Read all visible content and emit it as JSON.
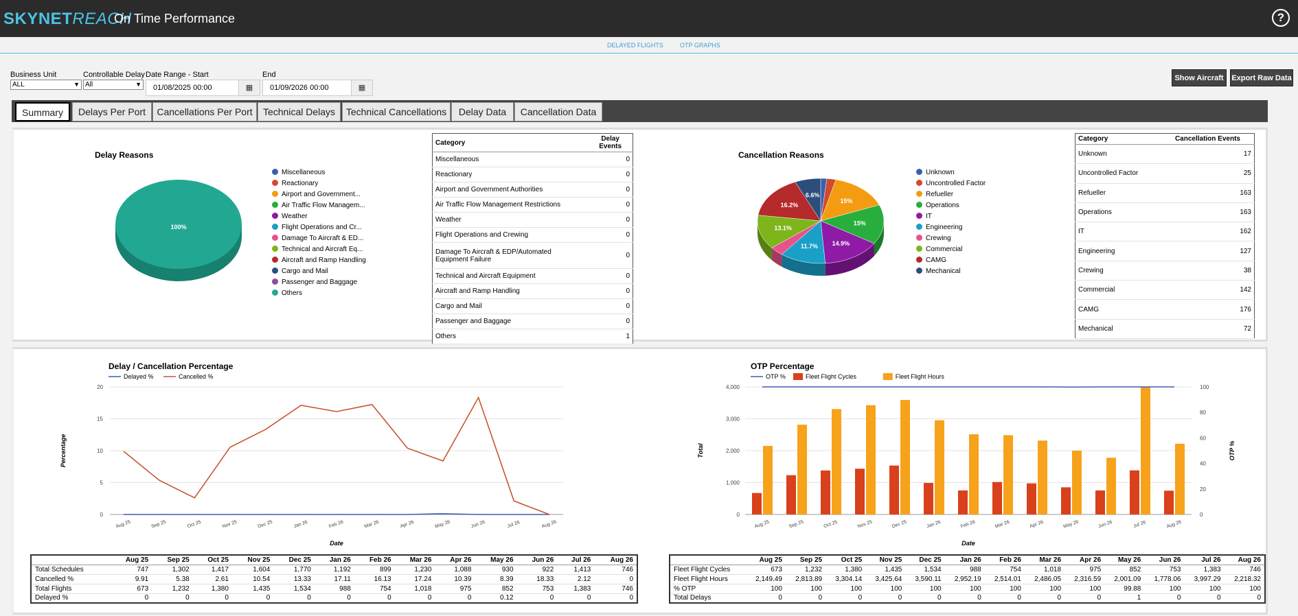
{
  "header": {
    "logo_sky": "SKYNET",
    "logo_reach": "REACH",
    "title": "On Time Performance",
    "help_glyph": "?"
  },
  "subnav": {
    "delayed_flights": "DELAYED FLIGHTS",
    "otp_graphs": "OTP GRAPHS"
  },
  "filters": {
    "business_unit_label": "Business Unit",
    "business_unit_value": "ALL",
    "controllable_delay_label": "Controllable Delay",
    "controllable_delay_value": "All",
    "date_start_label": "Date Range - Start",
    "date_start_value": "01/08/2025 00:00",
    "date_end_label": "End",
    "date_end_value": "01/09/2026 00:00",
    "calendar_icon": "calendar-icon"
  },
  "buttons": {
    "show_aircraft": "Show Aircraft",
    "export_raw": "Export Raw Data"
  },
  "tabs": [
    {
      "label": "Summary",
      "active": true
    },
    {
      "label": "Delays Per Port"
    },
    {
      "label": "Cancellations Per Port"
    },
    {
      "label": "Technical Delays"
    },
    {
      "label": "Technical Cancellations"
    },
    {
      "label": "Delay Data"
    },
    {
      "label": "Cancellation Data"
    }
  ],
  "delay_table": {
    "col_category": "Category",
    "col_events": "Delay Events",
    "rows": [
      {
        "category": "Miscellaneous",
        "events": "0"
      },
      {
        "category": "Reactionary",
        "events": "0"
      },
      {
        "category": "Airport and Government Authorities",
        "events": "0"
      },
      {
        "category": "Air Traffic Flow Management Restrictions",
        "events": "0"
      },
      {
        "category": "Weather",
        "events": "0"
      },
      {
        "category": "Flight Operations and Crewing",
        "events": "0"
      },
      {
        "category": "Damage To Aircraft & EDP/Automated Equipment Failure",
        "events": "0"
      },
      {
        "category": "Technical and Aircraft Equipment",
        "events": "0"
      },
      {
        "category": "Aircraft and Ramp Handling",
        "events": "0"
      },
      {
        "category": "Cargo and Mail",
        "events": "0"
      },
      {
        "category": "Passenger and Baggage",
        "events": "0"
      },
      {
        "category": "Others",
        "events": "1"
      }
    ]
  },
  "cancel_table": {
    "col_category": "Category",
    "col_events": "Cancellation Events",
    "rows": [
      {
        "category": "Unknown",
        "events": "17"
      },
      {
        "category": "Uncontrolled Factor",
        "events": "25"
      },
      {
        "category": "Refueller",
        "events": "163"
      },
      {
        "category": "Operations",
        "events": "163"
      },
      {
        "category": "IT",
        "events": "162"
      },
      {
        "category": "Engineering",
        "events": "127"
      },
      {
        "category": "Crewing",
        "events": "38"
      },
      {
        "category": "Commercial",
        "events": "142"
      },
      {
        "category": "CAMG",
        "events": "176"
      },
      {
        "category": "Mechanical",
        "events": "72"
      }
    ]
  },
  "chart_data": [
    {
      "type": "pie",
      "title": "Delay Reasons",
      "legend": [
        {
          "label": "Miscellaneous",
          "color": "#3a5fb0"
        },
        {
          "label": "Reactionary",
          "color": "#d14a2a"
        },
        {
          "label": "Airport and Government...",
          "color": "#f39c12"
        },
        {
          "label": "Air Traffic Flow Managem...",
          "color": "#27ae3c"
        },
        {
          "label": "Weather",
          "color": "#8e1aa6"
        },
        {
          "label": "Flight Operations and Cr...",
          "color": "#1aa0c8"
        },
        {
          "label": "Damage To Aircraft & ED...",
          "color": "#e8528a"
        },
        {
          "label": "Technical and Aircraft Eq...",
          "color": "#7db51a"
        },
        {
          "label": "Aircraft and Ramp Handling",
          "color": "#b52a2a"
        },
        {
          "label": "Cargo and Mail",
          "color": "#2c4e7a"
        },
        {
          "label": "Passenger and Baggage",
          "color": "#8e4aa6"
        },
        {
          "label": "Others",
          "color": "#22a892"
        }
      ],
      "slices": [
        {
          "label": "Others",
          "value": 100,
          "display": "100%",
          "color": "#22a892"
        }
      ]
    },
    {
      "type": "pie",
      "title": "Cancellation Reasons",
      "legend": [
        {
          "label": "Unknown",
          "color": "#3a5fb0"
        },
        {
          "label": "Uncontrolled Factor",
          "color": "#d14a2a"
        },
        {
          "label": "Refueller",
          "color": "#f39c12"
        },
        {
          "label": "Operations",
          "color": "#27ae3c"
        },
        {
          "label": "IT",
          "color": "#8e1aa6"
        },
        {
          "label": "Engineering",
          "color": "#1aa0c8"
        },
        {
          "label": "Crewing",
          "color": "#e8528a"
        },
        {
          "label": "Commercial",
          "color": "#7db51a"
        },
        {
          "label": "CAMG",
          "color": "#b52a2a"
        },
        {
          "label": "Mechanical",
          "color": "#2c4e7a"
        }
      ],
      "slices": [
        {
          "label": "Unknown",
          "value": 17,
          "display": "",
          "color": "#3a5fb0"
        },
        {
          "label": "Uncontrolled Factor",
          "value": 25,
          "display": "",
          "color": "#d14a2a"
        },
        {
          "label": "Refueller",
          "value": 163,
          "display": "15%",
          "color": "#f39c12"
        },
        {
          "label": "Operations",
          "value": 163,
          "display": "15%",
          "color": "#27ae3c"
        },
        {
          "label": "IT",
          "value": 162,
          "display": "14.9%",
          "color": "#8e1aa6"
        },
        {
          "label": "Engineering",
          "value": 127,
          "display": "11.7%",
          "color": "#1aa0c8"
        },
        {
          "label": "Crewing",
          "value": 38,
          "display": "",
          "color": "#e8528a"
        },
        {
          "label": "Commercial",
          "value": 142,
          "display": "13.1%",
          "color": "#7db51a"
        },
        {
          "label": "CAMG",
          "value": 176,
          "display": "16.2%",
          "color": "#b52a2a"
        },
        {
          "label": "Mechanical",
          "value": 72,
          "display": "6.6%",
          "color": "#2c4e7a"
        }
      ]
    },
    {
      "type": "line",
      "title": "Delay / Cancellation Percentage",
      "xlabel": "Date",
      "ylabel": "Percentage",
      "ylim": [
        0,
        20
      ],
      "yticks": [
        0,
        5,
        10,
        15,
        20
      ],
      "categories": [
        "Aug 25",
        "Sep 25",
        "Oct 25",
        "Nov 25",
        "Dec 25",
        "Jan 26",
        "Feb 26",
        "Mar 26",
        "Apr 26",
        "May 26",
        "Jun 26",
        "Jul 26",
        "Aug 26"
      ],
      "series": [
        {
          "name": "Delayed %",
          "color": "#3a5fb0",
          "values": [
            0,
            0,
            0,
            0,
            0,
            0,
            0,
            0,
            0,
            0.12,
            0,
            0,
            0
          ]
        },
        {
          "name": "Cancelled %",
          "color": "#c9552e",
          "values": [
            9.91,
            5.38,
            2.61,
            10.54,
            13.33,
            17.11,
            16.13,
            17.24,
            10.39,
            8.39,
            18.33,
            2.12,
            0
          ]
        }
      ]
    },
    {
      "type": "bar",
      "title": "OTP Percentage",
      "xlabel": "Date",
      "ylabel": "Total",
      "ylabel_right": "OTP %",
      "ylim": [
        0,
        4000
      ],
      "yticks": [
        "0",
        "1,000",
        "2,000",
        "3,000",
        "4,000"
      ],
      "yticks_values": [
        0,
        1000,
        2000,
        3000,
        4000
      ],
      "ylim_right": [
        0,
        100
      ],
      "yticks_right": [
        0,
        20,
        40,
        60,
        80,
        100
      ],
      "categories": [
        "Aug 25",
        "Sep 25",
        "Oct 25",
        "Nov 25",
        "Dec 25",
        "Jan 26",
        "Feb 26",
        "Mar 26",
        "Apr 26",
        "May 26",
        "Jun 26",
        "Jul 26",
        "Aug 26"
      ],
      "series": [
        {
          "name": "OTP %",
          "type": "line",
          "axis": "right",
          "color": "#3a5fb0",
          "values": [
            100,
            100,
            100,
            100,
            100,
            100,
            100,
            100,
            100,
            99.88,
            100,
            100,
            100
          ]
        },
        {
          "name": "Fleet Flight Cycles",
          "type": "bar",
          "color": "#d9401c",
          "values": [
            673,
            1232,
            1380,
            1435,
            1534,
            988,
            754,
            1018,
            975,
            852,
            753,
            1383,
            746
          ]
        },
        {
          "name": "Fleet Flight Hours",
          "type": "bar",
          "color": "#f7a21b",
          "values": [
            2149.49,
            2813.89,
            3304.14,
            3425.64,
            3590.11,
            2952.19,
            2514.01,
            2486.05,
            2316.59,
            2001.09,
            1778.06,
            3997.29,
            2218.32
          ]
        }
      ]
    }
  ],
  "delay_summary": {
    "headers": [
      "Aug 25",
      "Sep 25",
      "Oct 25",
      "Nov 25",
      "Dec 25",
      "Jan 26",
      "Feb 26",
      "Mar 26",
      "Apr 26",
      "May 26",
      "Jun 26",
      "Jul 26",
      "Aug 26"
    ],
    "rows": [
      {
        "label": "Total Schedules",
        "values": [
          "747",
          "1,302",
          "1,417",
          "1,604",
          "1,770",
          "1,192",
          "899",
          "1,230",
          "1,088",
          "930",
          "922",
          "1,413",
          "746"
        ]
      },
      {
        "label": "Cancelled %",
        "values": [
          "9.91",
          "5.38",
          "2.61",
          "10.54",
          "13.33",
          "17.11",
          "16.13",
          "17.24",
          "10.39",
          "8.39",
          "18.33",
          "2.12",
          "0"
        ]
      },
      {
        "label": "Total Flights",
        "values": [
          "673",
          "1,232",
          "1,380",
          "1,435",
          "1,534",
          "988",
          "754",
          "1,018",
          "975",
          "852",
          "753",
          "1,383",
          "746"
        ]
      },
      {
        "label": "Delayed %",
        "values": [
          "0",
          "0",
          "0",
          "0",
          "0",
          "0",
          "0",
          "0",
          "0",
          "0.12",
          "0",
          "0",
          "0"
        ]
      }
    ]
  },
  "otp_summary": {
    "headers": [
      "Aug 25",
      "Sep 25",
      "Oct 25",
      "Nov 25",
      "Dec 25",
      "Jan 26",
      "Feb 26",
      "Mar 26",
      "Apr 26",
      "May 26",
      "Jun 26",
      "Jul 26",
      "Aug 26"
    ],
    "rows": [
      {
        "label": "Fleet Flight Cycles",
        "values": [
          "673",
          "1,232",
          "1,380",
          "1,435",
          "1,534",
          "988",
          "754",
          "1,018",
          "975",
          "852",
          "753",
          "1,383",
          "746"
        ]
      },
      {
        "label": "Fleet Flight Hours",
        "values": [
          "2,149.49",
          "2,813.89",
          "3,304.14",
          "3,425.64",
          "3,590.11",
          "2,952.19",
          "2,514.01",
          "2,486.05",
          "2,316.59",
          "2,001.09",
          "1,778.06",
          "3,997.29",
          "2,218.32"
        ]
      },
      {
        "label": "% OTP",
        "values": [
          "100",
          "100",
          "100",
          "100",
          "100",
          "100",
          "100",
          "100",
          "100",
          "99.88",
          "100",
          "100",
          "100"
        ]
      },
      {
        "label": "Total Delays",
        "values": [
          "0",
          "0",
          "0",
          "0",
          "0",
          "0",
          "0",
          "0",
          "0",
          "1",
          "0",
          "0",
          "0"
        ]
      }
    ]
  }
}
